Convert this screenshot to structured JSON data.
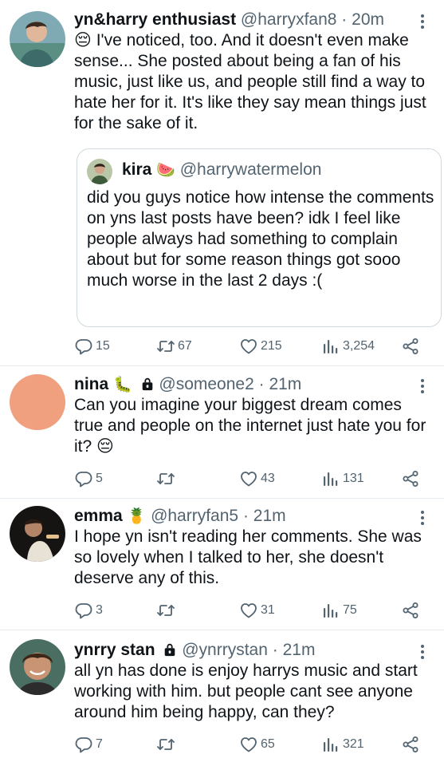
{
  "tweets": [
    {
      "name": "yn&harry enthusiast",
      "handle": "@harryxfan8",
      "time": "20m",
      "text": "😔 I've noticed, too. And it doesn't even make sense... She posted about being a fan of his music, just like us, and people still find a way to hate her for it. It's like they say mean things just for the sake of it.",
      "replies": "15",
      "retweets": "67",
      "likes": "215",
      "views": "3,254",
      "quote": {
        "name": "kira",
        "emoji": "🍉",
        "handle": "@harrywatermelon",
        "text": "did you guys notice how intense the comments on yns last posts have been? idk I feel like people always had something to complain about but for some reason things got sooo much worse in the last 2 days :("
      }
    },
    {
      "name": "nina",
      "emoji": "🐛",
      "handle": "@someone2",
      "time": "21m",
      "text": "Can you imagine your biggest dream comes true and people on the internet just hate you for it? 😔",
      "replies": "5",
      "retweets": "",
      "likes": "43",
      "views": "131",
      "avatar_color": "#f0a07e"
    },
    {
      "name": "emma",
      "emoji": "🍍",
      "handle": "@harryfan5",
      "time": "21m",
      "text": "I hope yn isn't reading her comments. She was so lovely when I talked to her, she doesn't deserve any of this.",
      "replies": "3",
      "retweets": "",
      "likes": "31",
      "views": "75"
    },
    {
      "name": "ynrry stan",
      "handle": "@ynrrystan",
      "time": "21m",
      "text": "all yn has done is enjoy harrys music and start working with him. but people cant see anyone around him being happy, can they?",
      "replies": "7",
      "retweets": "",
      "likes": "65",
      "views": "321"
    }
  ],
  "separator": "·",
  "icons": [
    "reply-icon",
    "retweet-icon",
    "like-icon",
    "views-icon",
    "share-icon",
    "more-icon",
    "lock-icon"
  ],
  "colors": {
    "text": "#0f1419",
    "secondary": "#536471",
    "divider": "#e6ecf0"
  }
}
